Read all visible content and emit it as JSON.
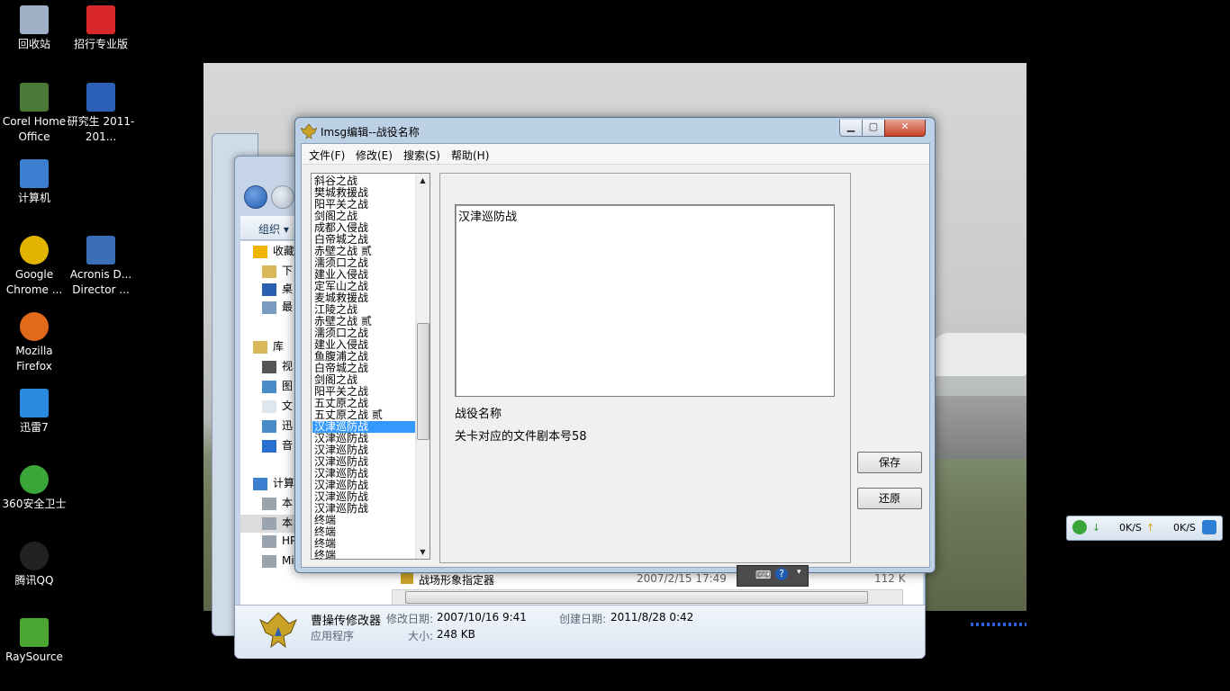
{
  "desktop": {
    "icons": [
      {
        "label": "回收站",
        "icon": "recycle-bin-icon"
      },
      {
        "label": "招行专业版",
        "icon": "cmb-icon"
      },
      {
        "label": "Corel Home Office",
        "icon": "corel-icon"
      },
      {
        "label": "研究生 2011-201...",
        "icon": "word-doc-icon"
      },
      {
        "label": "计算机",
        "icon": "computer-icon"
      },
      {
        "label": "Google Chrome ...",
        "icon": "chrome-icon"
      },
      {
        "label": "Acronis D... Director ...",
        "icon": "acronis-icon"
      },
      {
        "label": "Mozilla Firefox",
        "icon": "firefox-icon"
      },
      {
        "label": "迅雷7",
        "icon": "thunder-icon"
      },
      {
        "label": "360安全卫士",
        "icon": "360-icon"
      },
      {
        "label": "腾讯QQ",
        "icon": "qq-icon"
      },
      {
        "label": "RaySource",
        "icon": "raysource-icon"
      }
    ]
  },
  "explorer": {
    "organize": "组织 ▾",
    "nav": [
      {
        "label": "收藏",
        "icon": "star-icon"
      },
      {
        "label": "下",
        "icon": "download-folder-icon"
      },
      {
        "label": "桌",
        "icon": "desktop-folder-icon"
      },
      {
        "label": "最",
        "icon": "recent-icon"
      },
      {
        "label": "库",
        "icon": "library-icon"
      },
      {
        "label": "视",
        "icon": "video-icon"
      },
      {
        "label": "图",
        "icon": "picture-icon"
      },
      {
        "label": "文",
        "icon": "document-icon"
      },
      {
        "label": "迅",
        "icon": "thunder-folder-icon"
      },
      {
        "label": "音",
        "icon": "music-icon"
      },
      {
        "label": "计算",
        "icon": "computer-icon"
      },
      {
        "label": "本",
        "icon": "drive-icon"
      },
      {
        "label": "本",
        "icon": "drive-icon"
      },
      {
        "label": "HP ...",
        "icon": "drive-icon"
      },
      {
        "label": "Microsoft Office",
        "icon": "drive-icon"
      }
    ],
    "file_row": {
      "name": "战场形象指定器",
      "date": "2007/2/15 17:49",
      "size": "112 K"
    },
    "details": {
      "name": "曹操传修改器",
      "type": "应用程序",
      "modified_label": "修改日期:",
      "modified": "2007/10/16 9:41",
      "created_label": "创建日期:",
      "created": "2011/8/28 0:42",
      "size_label": "大小:",
      "size": "248 KB"
    }
  },
  "dialog": {
    "title": "Imsg编辑--战役名称",
    "menus": [
      "文件(F)",
      "修改(E)",
      "搜索(S)",
      "帮助(H)"
    ],
    "list": [
      "斜谷之战",
      "樊城救援战",
      "阳平关之战",
      "剑阁之战",
      "成都入侵战",
      "白帝城之战",
      "赤壁之战 贰",
      "濡须口之战",
      "建业入侵战",
      "定军山之战",
      "麦城救援战",
      "江陵之战",
      "赤壁之战 贰",
      "濡须口之战",
      "建业入侵战",
      "鱼腹浦之战",
      "白帝城之战",
      "剑阁之战",
      "阳平关之战",
      "五丈原之战",
      "五丈原之战 贰",
      "汉津巡防战",
      "汉津巡防战",
      "汉津巡防战",
      "汉津巡防战",
      "汉津巡防战",
      "汉津巡防战",
      "汉津巡防战",
      "汉津巡防战",
      "终端",
      "终端",
      "终端",
      "终端"
    ],
    "selected_index": 21,
    "edit_text": "汉津巡防战",
    "field_label": "战役名称",
    "info_label": "关卡对应的文件剧本号58",
    "save_button": "保存",
    "restore_button": "还原"
  },
  "tray": {
    "down": "0K/S",
    "up": "0K/S"
  },
  "colors": {
    "selection": "#3399ff",
    "dialog_frame": "#bcd0e6"
  }
}
